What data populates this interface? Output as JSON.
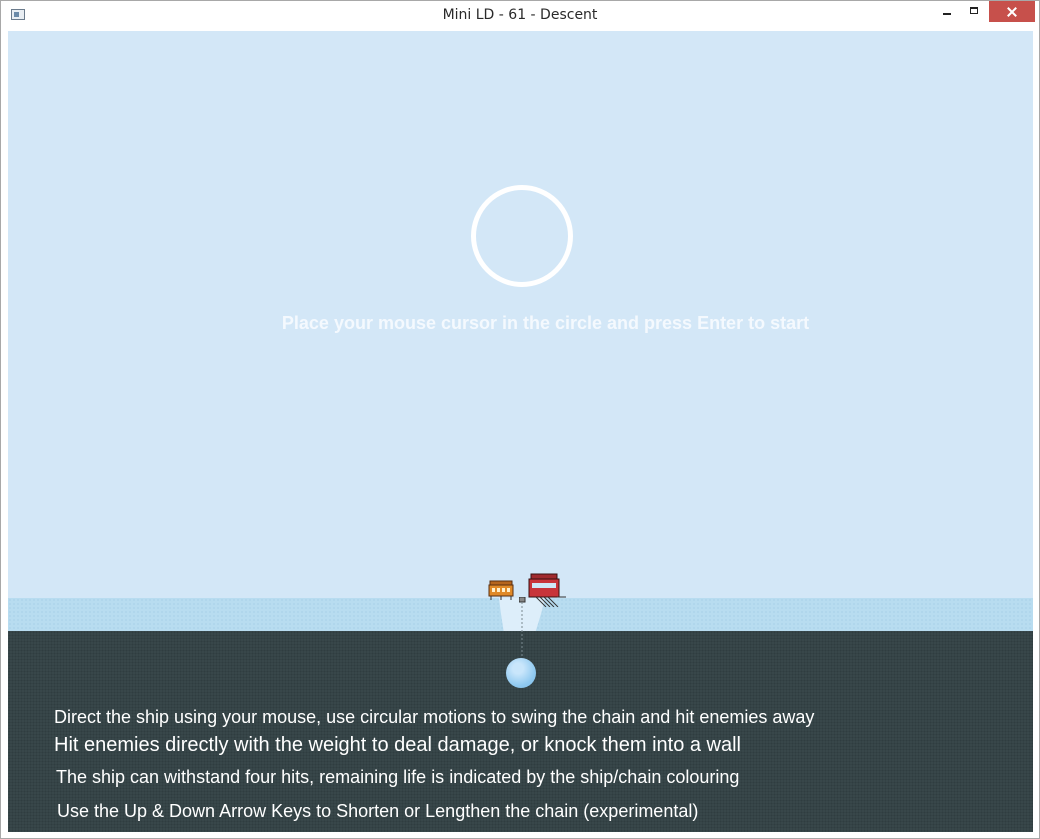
{
  "window": {
    "title": "Mini LD - 61 - Descent",
    "icon": "app-window-icon",
    "controls": [
      "minimize-icon",
      "maximize-icon",
      "close-icon"
    ]
  },
  "game": {
    "start_prompt": "Place your mouse cursor in the circle and press Enter to start",
    "instructions": {
      "line1": "Direct the ship using your mouse, use circular motions to swing the chain and  hit enemies away",
      "line2": "Hit enemies directly with the weight to deal damage, or knock them into a wall",
      "line3": "The ship can withstand four hits, remaining life is indicated by the ship/chain colouring",
      "line4": "Use the Up & Down Arrow Keys to Shorten or Lengthen the chain (experimental)"
    },
    "colors": {
      "sky": "#d3e7f7",
      "water_surface": "#b8dcf0",
      "deep_water": "#38474a",
      "player_ship": "#c8343a",
      "enemy_ship": "#e08a28",
      "weight": "#8fc9f0",
      "text": "#ffffff"
    }
  }
}
